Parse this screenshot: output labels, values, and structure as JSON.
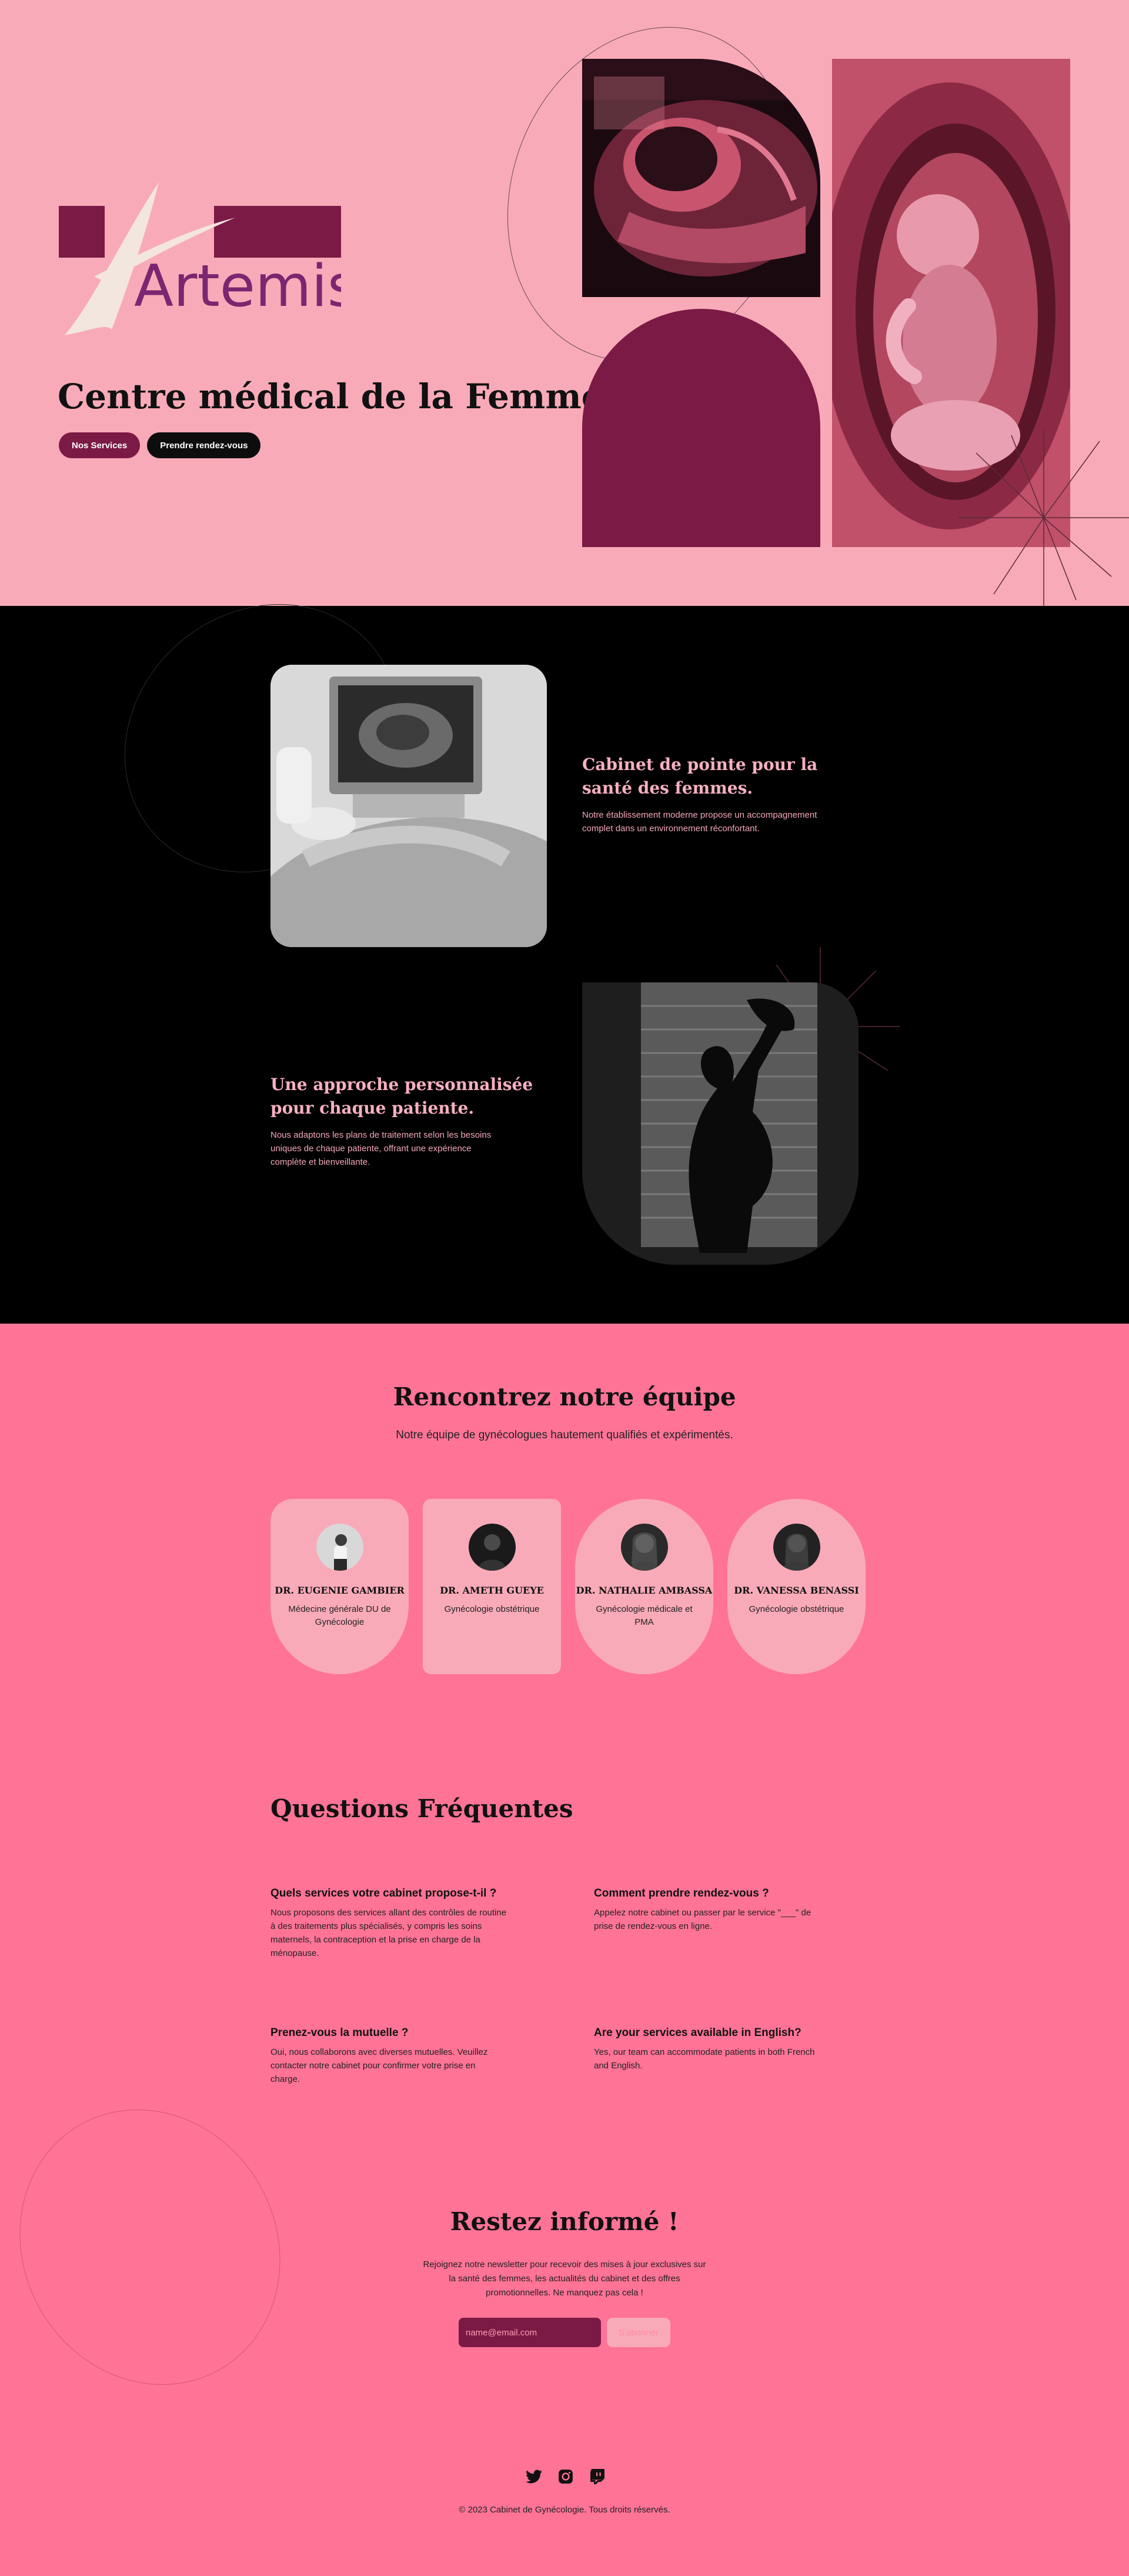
{
  "hero": {
    "logo_text": "Artemis",
    "title": "Centre médical de la Femme",
    "btn_services": "Nos Services",
    "btn_appointment": "Prendre rendez-vous"
  },
  "features": [
    {
      "title": "Cabinet de pointe pour la santé des femmes.",
      "body": "Notre établissement moderne propose un accompagnement complet  dans un environnement réconfortant."
    },
    {
      "title": "Une approche personnalisée pour chaque patiente.",
      "body": "Nous adaptons les plans de traitement selon les besoins uniques de chaque patiente, offrant une expérience complète et bienveillante."
    }
  ],
  "team": {
    "title": "Rencontrez notre équipe",
    "subtitle": "Notre équipe de gynécologues hautement qualifiés et expérimentés.",
    "members": [
      {
        "name": "DR. EUGENIE GAMBIER",
        "role": "Médecine générale DU de Gynécologie"
      },
      {
        "name": "DR. AMETH GUEYE",
        "role": "Gynécologie obstétrique"
      },
      {
        "name": "DR. NATHALIE AMBASSA",
        "role": "Gynécologie médicale et PMA"
      },
      {
        "name": "DR. VANESSA BENASSI",
        "role": "Gynécologie obstétrique"
      }
    ]
  },
  "faq": {
    "title": "Questions Fréquentes",
    "items": [
      {
        "q": "Quels services votre cabinet propose-t-il ?",
        "a": "Nous proposons des services allant des contrôles de routine à des traitements plus spécialisés, y compris les soins maternels, la contraception et la prise en charge de la ménopause."
      },
      {
        "q": "Comment prendre rendez-vous ?",
        "a": "Appelez notre cabinet ou passer par le service \"___\" de prise de rendez-vous en ligne."
      },
      {
        "q": "Prenez-vous la mutuelle ?",
        "a": "Oui, nous collaborons avec diverses mutuelles. Veuillez contacter notre cabinet pour confirmer votre prise en charge."
      },
      {
        "q": "Are your services available in English?",
        "a": "Yes, our team can accommodate patients in both French and English."
      }
    ]
  },
  "newsletter": {
    "title": "Restez informé !",
    "text": "Rejoignez notre newsletter pour recevoir des mises à jour exclusives sur la santé des femmes, les actualités du cabinet et des offres promotionnelles. Ne manquez pas cela !",
    "placeholder": "name@email.com",
    "button": "S'abonner"
  },
  "footer": {
    "socials": [
      "twitter-icon",
      "instagram-icon",
      "twitch-icon"
    ],
    "copyright": "© 2023 Cabinet de  Gynécologie. Tous droits réservés."
  },
  "colors": {
    "hero_bg": "#f9aab8",
    "burgundy": "#7b1a45",
    "accent_pink": "#ff7396",
    "dark": "#000000"
  }
}
